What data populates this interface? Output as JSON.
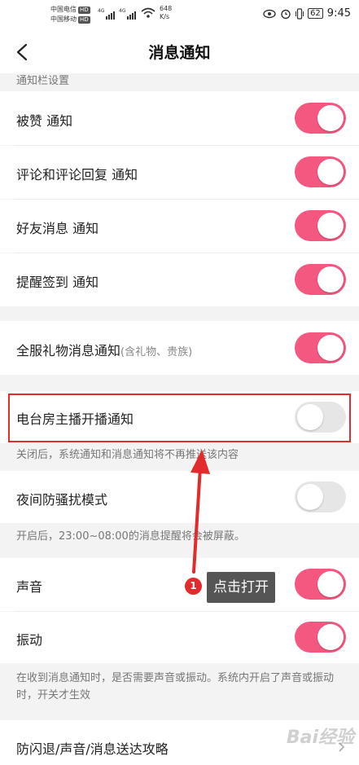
{
  "status_bar": {
    "carrier1": "中国电信",
    "carrier2": "中国移动",
    "hd": "HD",
    "net_tag": "4G",
    "net_speed_value": "648",
    "net_speed_unit": "K/s",
    "battery": "62",
    "time": "9:45"
  },
  "nav": {
    "title": "消息通知"
  },
  "section_notifications": "通知栏设置",
  "items": {
    "liked": {
      "label": "被赞 通知",
      "on": true
    },
    "comments": {
      "label": "评论和评论回复 通知",
      "on": true
    },
    "friend_msg": {
      "label": "好友消息 通知",
      "on": true
    },
    "checkin": {
      "label": "提醒签到 通知",
      "on": true
    },
    "gift": {
      "label": "全服礼物消息通知",
      "sub": "(含礼物、贵族)",
      "on": true
    },
    "radio_host": {
      "label": "电台房主播开播通知",
      "on": false
    },
    "night": {
      "label": "夜间防骚扰模式",
      "on": false
    },
    "sound": {
      "label": "声音",
      "on": true
    },
    "vibrate": {
      "label": "振动",
      "on": true
    },
    "guide": {
      "label": "防闪退/声音/消息送达攻略"
    }
  },
  "hints": {
    "radio_host": "关闭后，系统通知和消息通知将不再推送该内容",
    "night": "开启后，23:00~08:00的消息提醒将会被屏蔽。",
    "sound": "在收到消息通知时，是否需要声音或振动。系统内开启了声音或振动时，开关才生效"
  },
  "annotation": {
    "step": "1",
    "tip": "点击打开"
  },
  "watermark": "Bai经验",
  "colors": {
    "accent": "#f4577f",
    "highlight": "#e32b2b"
  }
}
